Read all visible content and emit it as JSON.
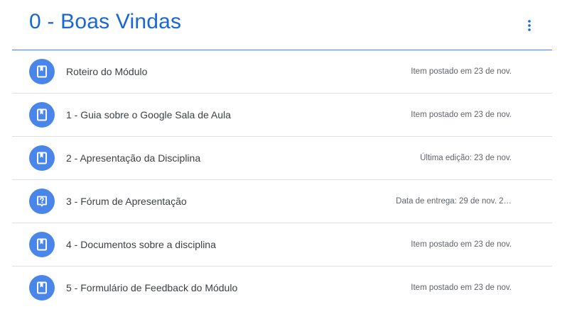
{
  "topic": {
    "title": "0 - Boas Vindas",
    "more_icon": "more-vert-icon"
  },
  "colors": {
    "accent": "#1967d2",
    "divider_accent": "#4285f4",
    "icon_bg": "#4a86ea",
    "text_primary": "#3c4043",
    "text_secondary": "#5f6368"
  },
  "items": [
    {
      "icon": "material-icon",
      "title": "Roteiro do Módulo",
      "meta": "Item postado em 23 de nov."
    },
    {
      "icon": "material-icon",
      "title": "1 - Guia sobre o Google Sala de Aula",
      "meta": "Item postado em 23 de nov."
    },
    {
      "icon": "material-icon",
      "title": "2 - Apresentação da Disciplina",
      "meta": "Última edição: 23 de nov."
    },
    {
      "icon": "question-icon",
      "title": "3 - Fórum de Apresentação",
      "meta": "Data de entrega: 29 de nov. 2…"
    },
    {
      "icon": "material-icon",
      "title": "4 - Documentos sobre a disciplina",
      "meta": "Item postado em 23 de nov."
    },
    {
      "icon": "material-icon",
      "title": "5 - Formulário de Feedback do Módulo",
      "meta": "Item postado em 23 de nov."
    }
  ]
}
